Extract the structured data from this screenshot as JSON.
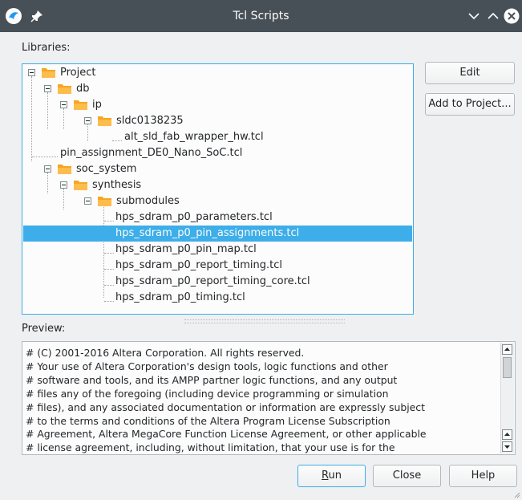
{
  "window": {
    "title": "Tcl Scripts"
  },
  "libraries": {
    "label": "Libraries:",
    "tree": [
      {
        "label": "Project",
        "kind": "folder",
        "expanded": true
      },
      {
        "label": "db",
        "kind": "folder",
        "expanded": true
      },
      {
        "label": "ip",
        "kind": "folder",
        "expanded": true
      },
      {
        "label": "sldc0138235",
        "kind": "folder",
        "expanded": true
      },
      {
        "label": "alt_sld_fab_wrapper_hw.tcl",
        "kind": "file"
      },
      {
        "label": "pin_assignment_DE0_Nano_SoC.tcl",
        "kind": "file"
      },
      {
        "label": "soc_system",
        "kind": "folder",
        "expanded": true
      },
      {
        "label": "synthesis",
        "kind": "folder",
        "expanded": true
      },
      {
        "label": "submodules",
        "kind": "folder",
        "expanded": true
      },
      {
        "label": "hps_sdram_p0_parameters.tcl",
        "kind": "file"
      },
      {
        "label": "hps_sdram_p0_pin_assignments.tcl",
        "kind": "file",
        "selected": true
      },
      {
        "label": "hps_sdram_p0_pin_map.tcl",
        "kind": "file"
      },
      {
        "label": "hps_sdram_p0_report_timing.tcl",
        "kind": "file"
      },
      {
        "label": "hps_sdram_p0_report_timing_core.tcl",
        "kind": "file"
      },
      {
        "label": "hps_sdram_p0_timing.tcl",
        "kind": "file"
      }
    ]
  },
  "side_buttons": {
    "edit": "Edit",
    "add_to_project": "Add to Project..."
  },
  "preview": {
    "label": "Preview:",
    "lines": [
      "# (C) 2001-2016 Altera Corporation. All rights reserved.",
      "# Your use of Altera Corporation's design tools, logic functions and other",
      "# software and tools, and its AMPP partner logic functions, and any output",
      "# files any of the foregoing (including device programming or simulation",
      "# files), and any associated documentation or information are expressly subject",
      "# to the terms and conditions of the Altera Program License Subscription",
      "# Agreement, Altera MegaCore Function License Agreement, or other applicable",
      "# license agreement, including, without limitation, that your use is for the"
    ]
  },
  "footer": {
    "run_mnemonic": "R",
    "run_rest": "un",
    "close": "Close",
    "help": "Help"
  },
  "colors": {
    "titlebar": "#475057",
    "selection": "#3daee9",
    "folder": "#fdbc4b",
    "background": "#eff0f1"
  },
  "icons": {
    "app": "app-logo-icon",
    "pin": "pin-icon",
    "minimize": "chevron-down-icon",
    "maximize": "chevron-up-icon",
    "close": "close-icon",
    "folder": "folder-icon"
  }
}
